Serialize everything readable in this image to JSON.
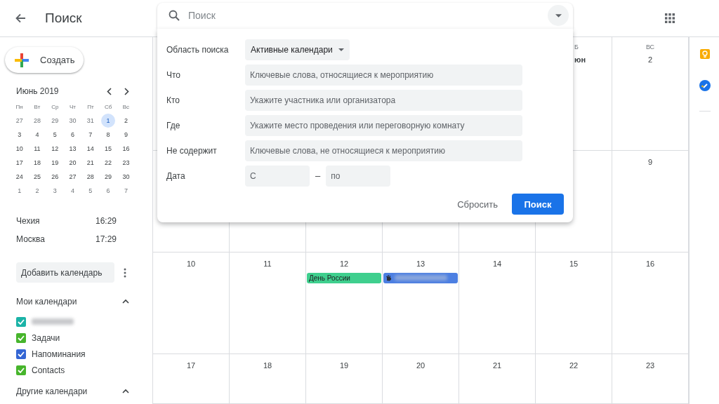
{
  "header": {
    "title": "Поиск",
    "search": {
      "placeholder": "Поиск"
    }
  },
  "search_panel": {
    "scope": {
      "label": "Область поиска",
      "value": "Активные календари"
    },
    "fields": [
      {
        "label": "Что",
        "placeholder": "Ключевые слова, относящиеся к мероприятию"
      },
      {
        "label": "Кто",
        "placeholder": "Укажите участника или организатора"
      },
      {
        "label": "Где",
        "placeholder": "Укажите место проведения или переговорную комнату"
      },
      {
        "label": "Не содержит",
        "placeholder": "Ключевые слова, не относящиеся к мероприятию"
      }
    ],
    "date": {
      "label": "Дата",
      "from_placeholder": "С",
      "separator": "–",
      "to_placeholder": "по"
    },
    "buttons": [
      {
        "label": "Сбросить",
        "kind": "text"
      },
      {
        "label": "Поиск",
        "kind": "primary"
      }
    ]
  },
  "sidebar": {
    "create_button": "Создать",
    "mini_calendar": {
      "title": "Июнь 2019",
      "weekdays": [
        "Пн",
        "Вт",
        "Ср",
        "Чт",
        "Пт",
        "Сб",
        "Вс"
      ],
      "weeks": [
        {
          "days": [
            {
              "text": "27",
              "other_month": true,
              "selected": false
            },
            {
              "text": "28",
              "other_month": true,
              "selected": false
            },
            {
              "text": "29",
              "other_month": true,
              "selected": false
            },
            {
              "text": "30",
              "other_month": true,
              "selected": false
            },
            {
              "text": "31",
              "other_month": true,
              "selected": false
            },
            {
              "text": "1",
              "other_month": false,
              "selected": true
            },
            {
              "text": "2",
              "other_month": false,
              "selected": false
            }
          ]
        },
        {
          "days": [
            {
              "text": "3",
              "other_month": false,
              "selected": false
            },
            {
              "text": "4",
              "other_month": false,
              "selected": false
            },
            {
              "text": "5",
              "other_month": false,
              "selected": false
            },
            {
              "text": "6",
              "other_month": false,
              "selected": false
            },
            {
              "text": "7",
              "other_month": false,
              "selected": false
            },
            {
              "text": "8",
              "other_month": false,
              "selected": false
            },
            {
              "text": "9",
              "other_month": false,
              "selected": false
            }
          ]
        },
        {
          "days": [
            {
              "text": "10",
              "other_month": false,
              "selected": false
            },
            {
              "text": "11",
              "other_month": false,
              "selected": false
            },
            {
              "text": "12",
              "other_month": false,
              "selected": false
            },
            {
              "text": "13",
              "other_month": false,
              "selected": false
            },
            {
              "text": "14",
              "other_month": false,
              "selected": false
            },
            {
              "text": "15",
              "other_month": false,
              "selected": false
            },
            {
              "text": "16",
              "other_month": false,
              "selected": false
            }
          ]
        },
        {
          "days": [
            {
              "text": "17",
              "other_month": false,
              "selected": false
            },
            {
              "text": "18",
              "other_month": false,
              "selected": false
            },
            {
              "text": "19",
              "other_month": false,
              "selected": false
            },
            {
              "text": "20",
              "other_month": false,
              "selected": false
            },
            {
              "text": "21",
              "other_month": false,
              "selected": false
            },
            {
              "text": "22",
              "other_month": false,
              "selected": false
            },
            {
              "text": "23",
              "other_month": false,
              "selected": false
            }
          ]
        },
        {
          "days": [
            {
              "text": "24",
              "other_month": false,
              "selected": false
            },
            {
              "text": "25",
              "other_month": false,
              "selected": false
            },
            {
              "text": "26",
              "other_month": false,
              "selected": false
            },
            {
              "text": "27",
              "other_month": false,
              "selected": false
            },
            {
              "text": "28",
              "other_month": false,
              "selected": false
            },
            {
              "text": "29",
              "other_month": false,
              "selected": false
            },
            {
              "text": "30",
              "other_month": false,
              "selected": false
            }
          ]
        },
        {
          "days": [
            {
              "text": "1",
              "other_month": true,
              "selected": false
            },
            {
              "text": "2",
              "other_month": true,
              "selected": false
            },
            {
              "text": "3",
              "other_month": true,
              "selected": false
            },
            {
              "text": "4",
              "other_month": true,
              "selected": false
            },
            {
              "text": "5",
              "other_month": true,
              "selected": false
            },
            {
              "text": "6",
              "other_month": true,
              "selected": false
            },
            {
              "text": "7",
              "other_month": true,
              "selected": false
            }
          ]
        }
      ]
    },
    "clocks": [
      {
        "place": "Чехия",
        "time": "16:29"
      },
      {
        "place": "Москва",
        "time": "17:29"
      }
    ],
    "add_calendar": {
      "placeholder": "Добавить календарь"
    },
    "sections": [
      {
        "title": "Мои календари",
        "expanded": true,
        "items": [
          {
            "redacted": true,
            "checked": true,
            "color": "#1bb3a7"
          },
          {
            "label": "Задачи",
            "redacted": false,
            "checked": true,
            "color": "#47b52c"
          },
          {
            "label": "Напоминания",
            "redacted": false,
            "checked": true,
            "color": "#3466d4"
          },
          {
            "label": "Contacts",
            "redacted": false,
            "checked": true,
            "color": "#47b52c"
          }
        ]
      },
      {
        "title": "Другие календари",
        "expanded": true
      }
    ]
  },
  "calendar": {
    "weeks": [
      {
        "days": [
          {
            "weekday": "Б",
            "date": "юн",
            "kind": "partial"
          },
          {
            "weekday": "ВС",
            "date": "2"
          }
        ]
      },
      {
        "days": [
          {
            "date": "9"
          }
        ]
      },
      {
        "days": [
          {
            "date": "10"
          },
          {
            "date": "11"
          },
          {
            "date": "12",
            "events": [
              {
                "kind": "text",
                "title": "День России",
                "color": "#3fcf8e"
              }
            ]
          },
          {
            "date": "13",
            "events": [
              {
                "kind": "redacted",
                "color": "#4c7fe2"
              }
            ]
          },
          {
            "date": "14"
          },
          {
            "date": "15"
          },
          {
            "date": "16"
          }
        ]
      },
      {
        "days": [
          {
            "date": "17"
          },
          {
            "date": "18"
          },
          {
            "date": "19"
          },
          {
            "date": "20"
          },
          {
            "date": "21"
          },
          {
            "date": "22"
          },
          {
            "date": "23"
          }
        ]
      }
    ]
  }
}
